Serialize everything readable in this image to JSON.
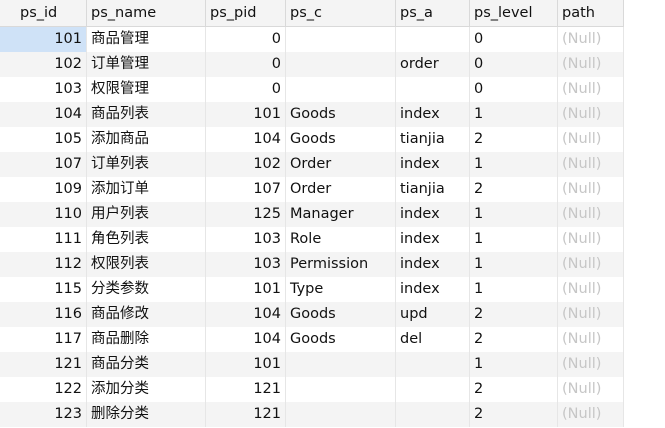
{
  "columns": [
    "ps_id",
    "ps_name",
    "ps_pid",
    "ps_c",
    "ps_a",
    "ps_level",
    "path"
  ],
  "rows": [
    {
      "ps_id": "101",
      "ps_name": "商品管理",
      "ps_pid": "0",
      "ps_c": "",
      "ps_a": "",
      "ps_level": "0",
      "path": "(Null)"
    },
    {
      "ps_id": "102",
      "ps_name": "订单管理",
      "ps_pid": "0",
      "ps_c": "",
      "ps_a": "order",
      "ps_level": "0",
      "path": "(Null)"
    },
    {
      "ps_id": "103",
      "ps_name": "权限管理",
      "ps_pid": "0",
      "ps_c": "",
      "ps_a": "",
      "ps_level": "0",
      "path": "(Null)"
    },
    {
      "ps_id": "104",
      "ps_name": "商品列表",
      "ps_pid": "101",
      "ps_c": "Goods",
      "ps_a": "index",
      "ps_level": "1",
      "path": "(Null)"
    },
    {
      "ps_id": "105",
      "ps_name": "添加商品",
      "ps_pid": "104",
      "ps_c": "Goods",
      "ps_a": "tianjia",
      "ps_level": "2",
      "path": "(Null)"
    },
    {
      "ps_id": "107",
      "ps_name": "订单列表",
      "ps_pid": "102",
      "ps_c": "Order",
      "ps_a": "index",
      "ps_level": "1",
      "path": "(Null)"
    },
    {
      "ps_id": "109",
      "ps_name": "添加订单",
      "ps_pid": "107",
      "ps_c": "Order",
      "ps_a": "tianjia",
      "ps_level": "2",
      "path": "(Null)"
    },
    {
      "ps_id": "110",
      "ps_name": "用户列表",
      "ps_pid": "125",
      "ps_c": "Manager",
      "ps_a": "index",
      "ps_level": "1",
      "path": "(Null)"
    },
    {
      "ps_id": "111",
      "ps_name": "角色列表",
      "ps_pid": "103",
      "ps_c": "Role",
      "ps_a": "index",
      "ps_level": "1",
      "path": "(Null)"
    },
    {
      "ps_id": "112",
      "ps_name": "权限列表",
      "ps_pid": "103",
      "ps_c": "Permission",
      "ps_a": "index",
      "ps_level": "1",
      "path": "(Null)"
    },
    {
      "ps_id": "115",
      "ps_name": "分类参数",
      "ps_pid": "101",
      "ps_c": "Type",
      "ps_a": "index",
      "ps_level": "1",
      "path": "(Null)"
    },
    {
      "ps_id": "116",
      "ps_name": "商品修改",
      "ps_pid": "104",
      "ps_c": "Goods",
      "ps_a": "upd",
      "ps_level": "2",
      "path": "(Null)"
    },
    {
      "ps_id": "117",
      "ps_name": "商品删除",
      "ps_pid": "104",
      "ps_c": "Goods",
      "ps_a": "del",
      "ps_level": "2",
      "path": "(Null)"
    },
    {
      "ps_id": "121",
      "ps_name": "商品分类",
      "ps_pid": "101",
      "ps_c": "",
      "ps_a": "",
      "ps_level": "1",
      "path": "(Null)"
    },
    {
      "ps_id": "122",
      "ps_name": "添加分类",
      "ps_pid": "121",
      "ps_c": "",
      "ps_a": "",
      "ps_level": "2",
      "path": "(Null)"
    },
    {
      "ps_id": "123",
      "ps_name": "删除分类",
      "ps_pid": "121",
      "ps_c": "",
      "ps_a": "",
      "ps_level": "2",
      "path": "(Null)"
    }
  ],
  "selected_row": 0,
  "current_row_indicator": "row-pointer-icon",
  "colors": {
    "selected_cell": "#cfe2f7",
    "alt_row": "#f4f4f4",
    "null_text": "#c6c6c6"
  }
}
